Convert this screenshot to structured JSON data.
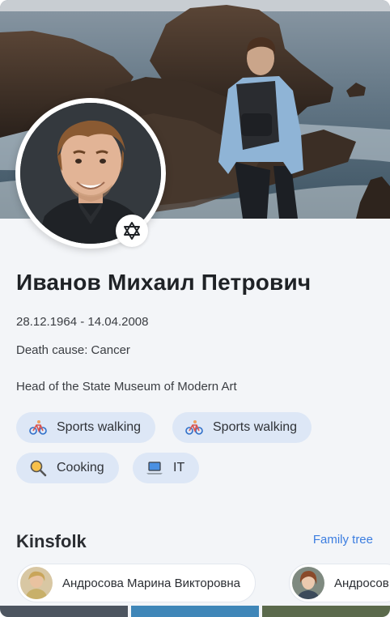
{
  "profile": {
    "name": "Иванов Михаил Петрович",
    "dates": "28.12.1964 - 14.04.2008",
    "death_cause": "Death cause: Cancer",
    "occupation": "Head of the State Museum of Modern Art",
    "religion_icon": "star-of-david-icon"
  },
  "hobbies": [
    {
      "label": "Sports walking",
      "icon": "bicycle-icon"
    },
    {
      "label": "Sports walking",
      "icon": "bicycle-icon"
    },
    {
      "label": "Cooking",
      "icon": "magnifier-icon"
    },
    {
      "label": "IT",
      "icon": "laptop-icon"
    }
  ],
  "kinsfolk": {
    "title": "Kinsfolk",
    "link_label": "Family tree",
    "people": [
      {
        "name": "Андросова Марина Викторовна"
      },
      {
        "name": "Андросов"
      }
    ]
  },
  "colors": {
    "accent": "#3b7de0",
    "tag_bg": "#dde7f6",
    "background": "#f3f5f8"
  }
}
